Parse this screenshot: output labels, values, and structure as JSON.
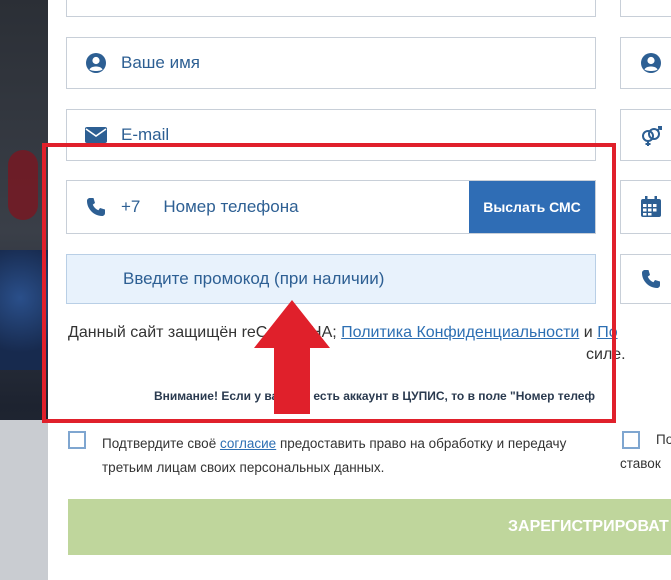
{
  "form": {
    "name_placeholder": "Ваше имя",
    "email_placeholder": "E-mail",
    "phone_prefix": "+7",
    "phone_placeholder": "Номер телефона",
    "sms_button": "Выслать СМС",
    "promo_placeholder": "Введите промокод (при наличии)"
  },
  "recaptcha": {
    "prefix": "Данный сайт защищён reCAPTCHA;",
    "privacy_link": "Политика Конфиденциальности",
    "conj": "и",
    "terms_link": "По",
    "suffix": "силе."
  },
  "warning": "Внимание! Если у вас уже есть аккаунт в ЦУПИС, то в поле \"Номер телеф",
  "consent": {
    "text_before": "Подтвердите своё",
    "link": "согласие",
    "text_after": "предоставить право на обработку и передачу третьим лицам своих персональных данных.",
    "right_line1": "По",
    "right_line2": "ставок"
  },
  "register_button": "ЗАРЕГИСТРИРОВАТ",
  "colors": {
    "accent": "#2f6db5",
    "register": "#bfd69c",
    "highlight": "#e0202b"
  }
}
